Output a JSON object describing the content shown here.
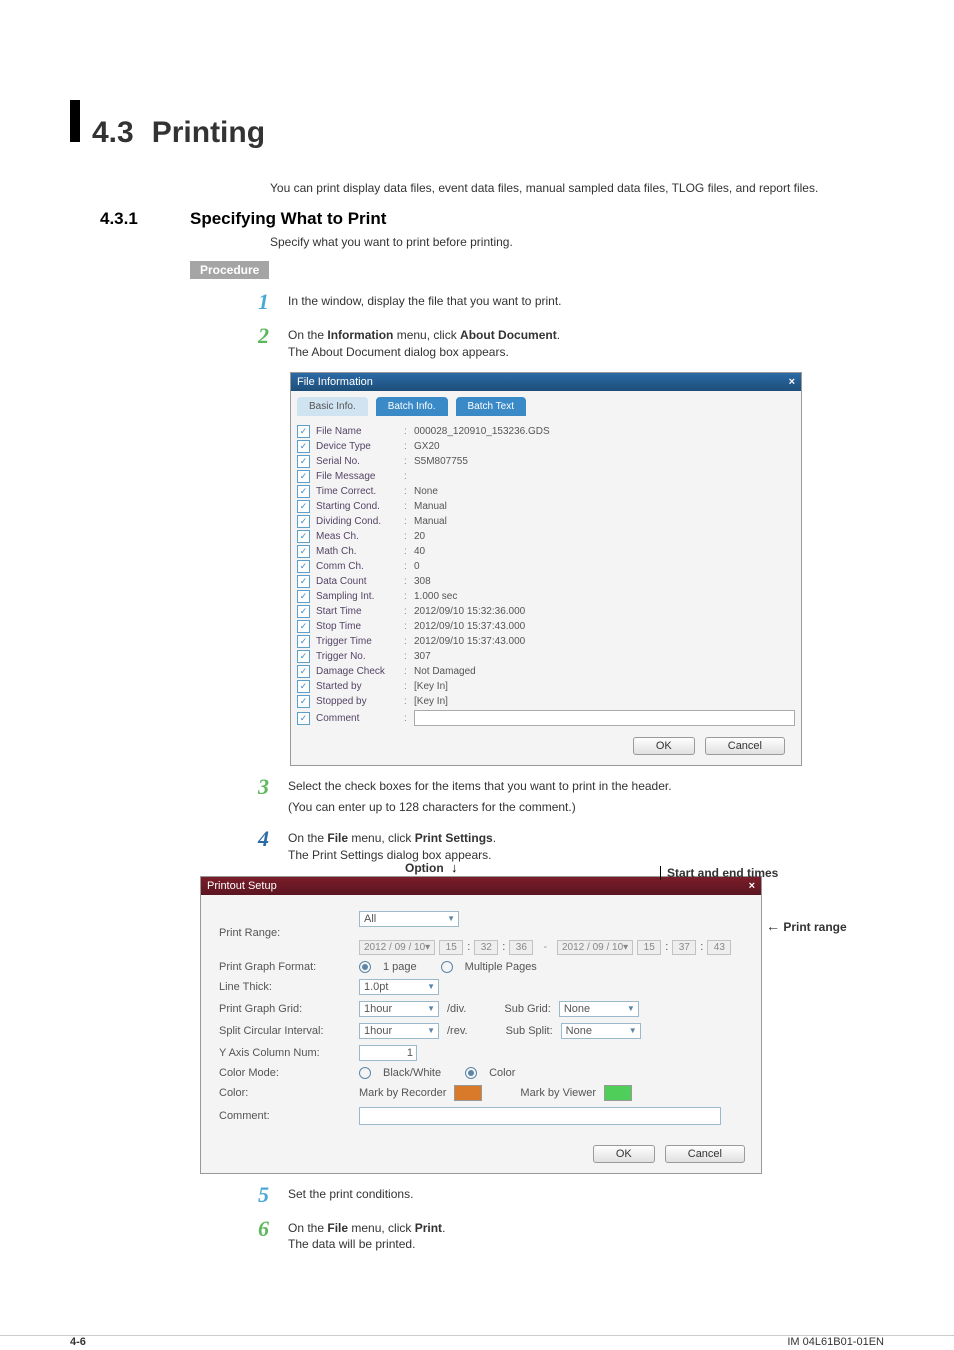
{
  "section": {
    "num": "4.3",
    "title": "Printing"
  },
  "intro": "You can print display data files, event data files, manual sampled data files, TLOG files, and report files.",
  "sub": {
    "num": "4.3.1",
    "title": "Specifying What to Print",
    "desc": "Specify what you want to print before printing."
  },
  "procedure_label": "Procedure",
  "steps": {
    "s1": "In the window, display the file that you want to print.",
    "s2a": "On the ",
    "s2b": "Information",
    "s2c": " menu, click ",
    "s2d": "About Document",
    "s2e": ".",
    "s2note": "The About Document dialog box appears.",
    "s3a": "Select the check boxes for the items that you want to print in the header.",
    "s3b": "(You can enter up to 128 characters for the comment.)",
    "s4a": "On the ",
    "s4b": "File",
    "s4c": " menu, click ",
    "s4d": "Print Settings",
    "s4e": ".",
    "s4note": "The Print Settings dialog box appears.",
    "s5": "Set the print conditions.",
    "s6a": "On the ",
    "s6b": "File",
    "s6c": " menu, click ",
    "s6d": "Print",
    "s6e": ".",
    "s6note": "The data will be printed."
  },
  "fileinfo": {
    "title": "File Information",
    "tabs": [
      "Basic Info.",
      "Batch Info.",
      "Batch Text"
    ],
    "rows": [
      {
        "label": "File Name",
        "val": "000028_120910_153236.GDS"
      },
      {
        "label": "Device Type",
        "val": "GX20"
      },
      {
        "label": "Serial No.",
        "val": "S5M807755"
      },
      {
        "label": "File Message",
        "val": ""
      },
      {
        "label": "Time Correct.",
        "val": "None"
      },
      {
        "label": "Starting Cond.",
        "val": "Manual"
      },
      {
        "label": "Dividing Cond.",
        "val": "Manual"
      },
      {
        "label": "Meas Ch.",
        "val": "20"
      },
      {
        "label": "Math Ch.",
        "val": "40"
      },
      {
        "label": "Comm Ch.",
        "val": "0"
      },
      {
        "label": "Data Count",
        "val": "308"
      },
      {
        "label": "Sampling Int.",
        "val": "1.000 sec"
      },
      {
        "label": "Start Time",
        "val": "2012/09/10 15:32:36.000"
      },
      {
        "label": "Stop Time",
        "val": "2012/09/10 15:37:43.000"
      },
      {
        "label": "Trigger Time",
        "val": "2012/09/10 15:37:43.000"
      },
      {
        "label": "Trigger No.",
        "val": "307"
      },
      {
        "label": "Damage Check",
        "val": "Not Damaged"
      },
      {
        "label": "Started by",
        "val": "[Key In]"
      },
      {
        "label": "Stopped by",
        "val": "[Key In]"
      },
      {
        "label": "Comment",
        "val": "",
        "input": true
      }
    ],
    "ok": "OK",
    "cancel": "Cancel",
    "close": "×"
  },
  "annot": {
    "option": "Option",
    "startend": "Start and end times",
    "printrange": "Print range"
  },
  "printout": {
    "title": "Printout Setup",
    "close": "×",
    "labels": {
      "range": "Print Range:",
      "format": "Print Graph Format:",
      "thick": "Line Thick:",
      "grid": "Print Graph Grid:",
      "circ": "Split Circular Interval:",
      "ycol": "Y Axis Column Num:",
      "cmode": "Color Mode:",
      "color": "Color:",
      "comment": "Comment:"
    },
    "vals": {
      "range": "All",
      "date1": "2012 / 09 / 10",
      "t1h": "15",
      "t1m": "32",
      "t1s": "36",
      "date2": "2012 / 09 / 10",
      "t2h": "15",
      "t2m": "37",
      "t2s": "43",
      "onepage": "1 page",
      "multi": "Multiple Pages",
      "thick": "1.0pt",
      "grid": "1hour",
      "div": "/div.",
      "subgrid_lbl": "Sub Grid:",
      "subgrid": "None",
      "circ": "1hour",
      "rev": "/rev.",
      "subsplit_lbl": "Sub Split:",
      "subsplit": "None",
      "ycol": "1",
      "bw": "Black/White",
      "colorOpt": "Color",
      "markrec": "Mark by Recorder",
      "markvw": "Mark by Viewer"
    },
    "ok": "OK",
    "cancel": "Cancel"
  },
  "footer": {
    "page": "4-6",
    "doc": "IM 04L61B01-01EN"
  }
}
